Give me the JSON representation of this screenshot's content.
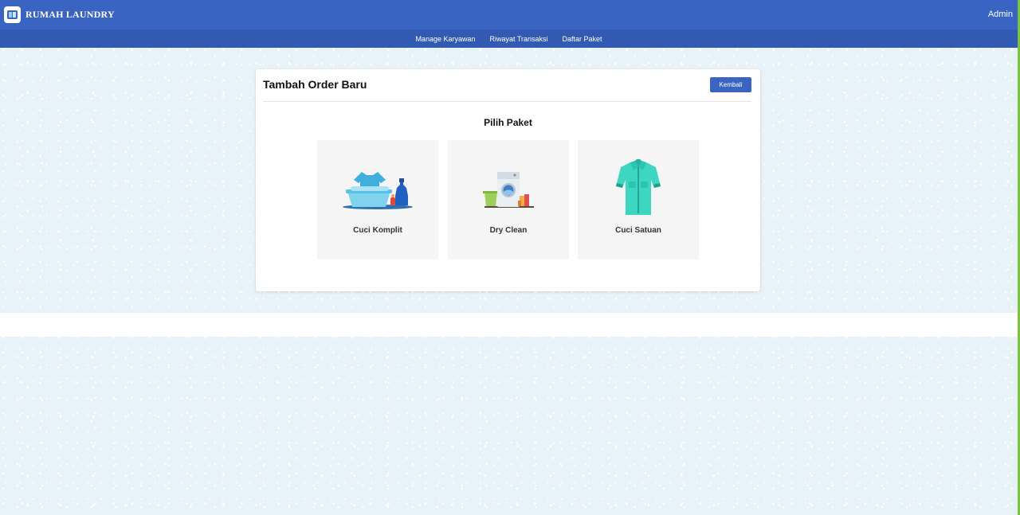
{
  "header": {
    "brand": "RUMAH LAUNDRY",
    "user": "Admin",
    "logo_icon": "laundry-logo-icon"
  },
  "nav": {
    "items": [
      {
        "label": "Manage Karyawan"
      },
      {
        "label": "Riwayat Transaksi"
      },
      {
        "label": "Daftar Paket"
      }
    ]
  },
  "card": {
    "title": "Tambah Order Baru",
    "back_label": "Kembali",
    "section_title": "Pilih Paket",
    "packages": [
      {
        "label": "Cuci Komplit",
        "icon": "laundry-basin-icon"
      },
      {
        "label": "Dry Clean",
        "icon": "washing-machine-icon"
      },
      {
        "label": "Cuci Satuan",
        "icon": "shirt-icon"
      }
    ]
  },
  "colors": {
    "primary": "#3a64c1",
    "nav": "#325ab3",
    "background": "#e8f2f9",
    "accent_edge": "#7dc242"
  }
}
